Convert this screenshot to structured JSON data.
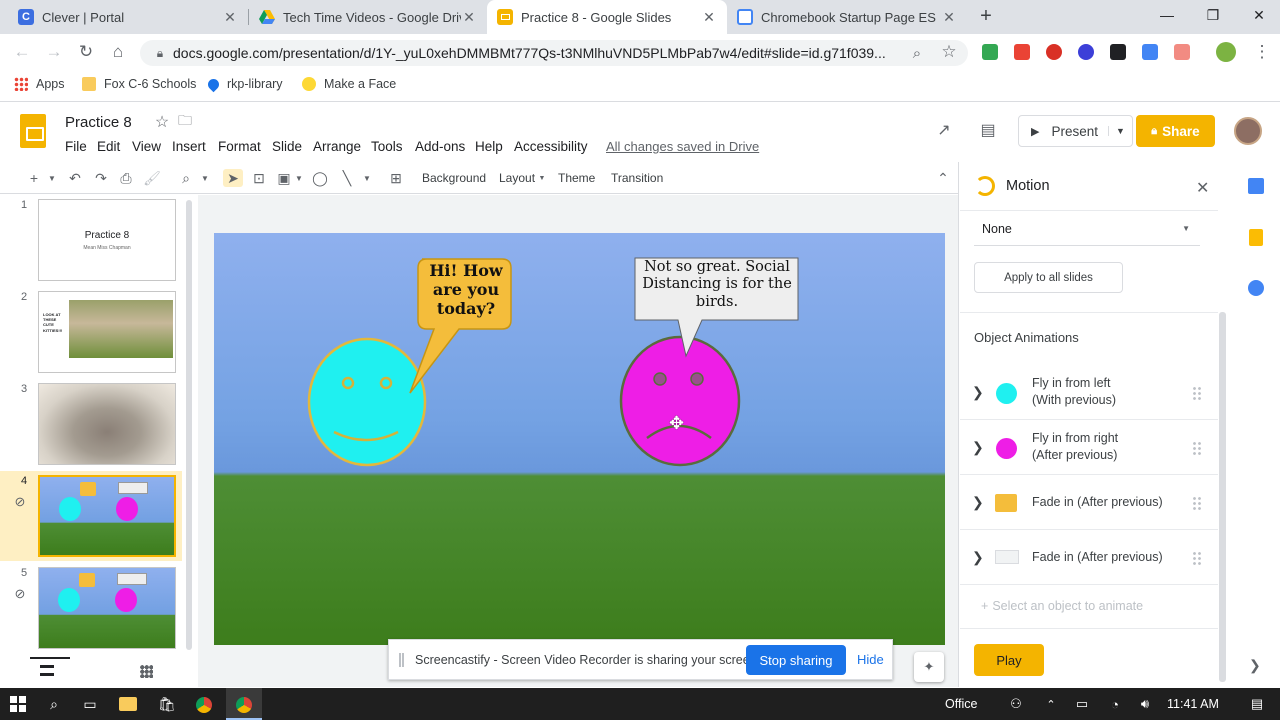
{
  "browser": {
    "tabs": [
      {
        "title": "Clever | Portal",
        "icon": "clever-icon",
        "color": "#3c6ee0"
      },
      {
        "title": "Tech Time Videos - Google Drive",
        "icon": "drive-icon",
        "color": "#0f9d58"
      },
      {
        "title": "Practice 8 - Google Slides",
        "icon": "slides-icon",
        "color": "#f4b400"
      },
      {
        "title": "Chromebook Startup Page ES",
        "icon": "sites-icon",
        "color": "#4285f4"
      }
    ],
    "url": "docs.google.com/presentation/d/1Y-_yuL0xehDMMBMt777Qs-t3NMlhuVND5PLMbPab7w4/edit#slide=id.g71f039...",
    "bookmarks": [
      "Apps",
      "Fox C-6 Schools",
      "rkp-library",
      "Make a Face"
    ]
  },
  "docs": {
    "title": "Practice 8",
    "menus": [
      "File",
      "Edit",
      "View",
      "Insert",
      "Format",
      "Slide",
      "Arrange",
      "Tools",
      "Add-ons",
      "Help",
      "Accessibility"
    ],
    "saved_status": "All changes saved in Drive",
    "present_label": "Present",
    "share_label": "Share"
  },
  "toolbar": {
    "background": "Background",
    "layout": "Layout",
    "theme": "Theme",
    "transition": "Transition"
  },
  "filmstrip": {
    "numbers": [
      "1",
      "2",
      "3",
      "4",
      "5"
    ],
    "slide1_title": "Practice 8",
    "slide1_sub": "Mean Miss Chapman",
    "slide2_text": "LOOK AT THESE CUTE KITTIES!!!"
  },
  "slide": {
    "left_bubble": "Hi! How are you today?",
    "right_bubble": "Not so great. Social Distancing is for the birds."
  },
  "sharebar": {
    "message": "Screencastify - Screen Video Recorder is sharing your screen.",
    "stop": "Stop sharing",
    "hide": "Hide"
  },
  "motion": {
    "title": "Motion",
    "transition_value": "None",
    "apply_all": "Apply to all slides",
    "section": "Object Animations",
    "animations": [
      {
        "line1": "Fly in from left",
        "line2": "(With previous)",
        "thumb": "cyan-circle"
      },
      {
        "line1": "Fly in from right",
        "line2": "(After previous)",
        "thumb": "magenta-circle"
      },
      {
        "line1": "Fade in  (After previous)",
        "line2": "",
        "thumb": "yellow-bubble"
      },
      {
        "line1": "Fade in  (After previous)",
        "line2": "",
        "thumb": "white-bubble"
      }
    ],
    "add_hint": "Select an object to animate",
    "play": "Play"
  },
  "taskbar": {
    "office": "Office",
    "time": "11:41 AM"
  },
  "colors": {
    "accent": "#f4b400",
    "blue": "#1a73e8",
    "cyan": "#1ff0f0",
    "magenta": "#ee1ee6"
  }
}
